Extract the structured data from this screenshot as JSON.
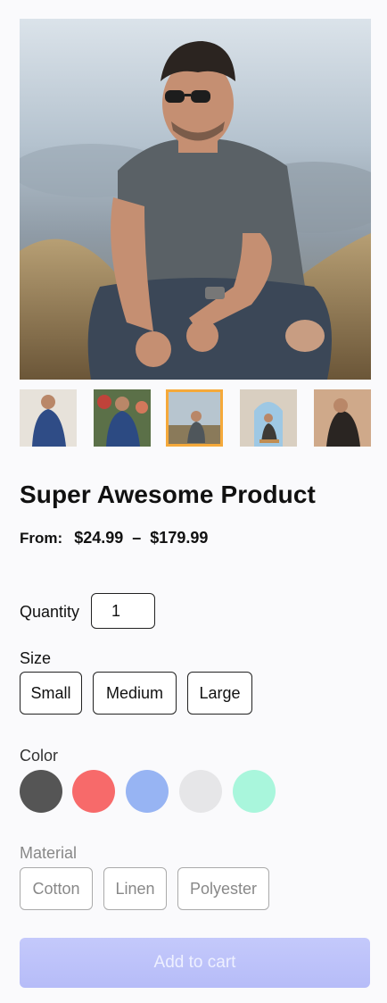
{
  "product": {
    "title": "Super Awesome Product",
    "price_prefix": "From:",
    "price_min": "$24.99",
    "price_sep": "–",
    "price_max": "$179.99"
  },
  "gallery": {
    "main_image": "man-in-sunglasses-crouching-on-hill-photo",
    "thumbnails": [
      {
        "name": "man-blue-denim-shirt-photo"
      },
      {
        "name": "man-blue-shirt-garden-photo"
      },
      {
        "name": "man-crouching-city-view-photo",
        "selected": true
      },
      {
        "name": "man-seated-arch-photo"
      },
      {
        "name": "man-leather-jacket-crouching-photo"
      }
    ],
    "selected_color": "#f5a93a"
  },
  "quantity": {
    "label": "Quantity",
    "value": "1"
  },
  "size": {
    "label": "Size",
    "options": [
      "Small",
      "Medium",
      "Large"
    ]
  },
  "color": {
    "label": "Color",
    "swatches": [
      "#555555",
      "#f76a6a",
      "#97b4f3",
      "#e6e6e8",
      "#a9f6dc"
    ]
  },
  "material": {
    "label": "Material",
    "options": [
      "Cotton",
      "Linen",
      "Polyester"
    ]
  },
  "cart": {
    "label": "Add to cart",
    "color": "#b9bef9"
  }
}
